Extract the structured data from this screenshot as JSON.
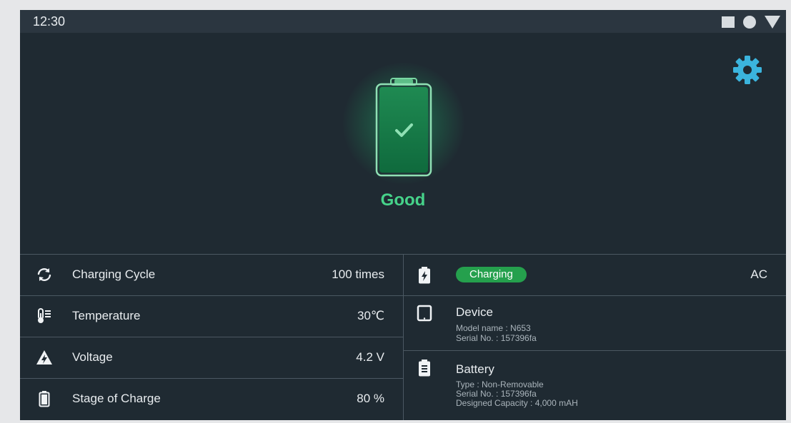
{
  "status_bar": {
    "time": "12:30",
    "icons": [
      "square-icon",
      "circle-icon",
      "triangle-down-icon"
    ]
  },
  "settings": {
    "icon": "gear-icon",
    "color": "#3bb4dd"
  },
  "health": {
    "status": "Good",
    "color": "#46d38a",
    "icon": "battery-check-icon"
  },
  "metrics": [
    {
      "icon": "cycle-icon",
      "label": "Charging Cycle",
      "value": "100 times"
    },
    {
      "icon": "thermometer-icon",
      "label": "Temperature",
      "value": "30℃"
    },
    {
      "icon": "voltage-icon",
      "label": "Voltage",
      "value": "4.2 V"
    },
    {
      "icon": "battery-level-icon",
      "label": "Stage of Charge",
      "value": "80 %"
    }
  ],
  "charging": {
    "icon": "charging-bolt-icon",
    "status": "Charging",
    "source": "AC",
    "color": "#25a04d"
  },
  "device": {
    "icon": "tablet-icon",
    "title": "Device",
    "model": "Model name : N653",
    "serial": "Serial No. : 157396fa"
  },
  "battery": {
    "icon": "battery-info-icon",
    "title": "Battery",
    "type": "Type : Non-Removable",
    "serial": "Serial No. : 157396fa",
    "capacity": "Designed Capacity : 4,000 mAH"
  }
}
